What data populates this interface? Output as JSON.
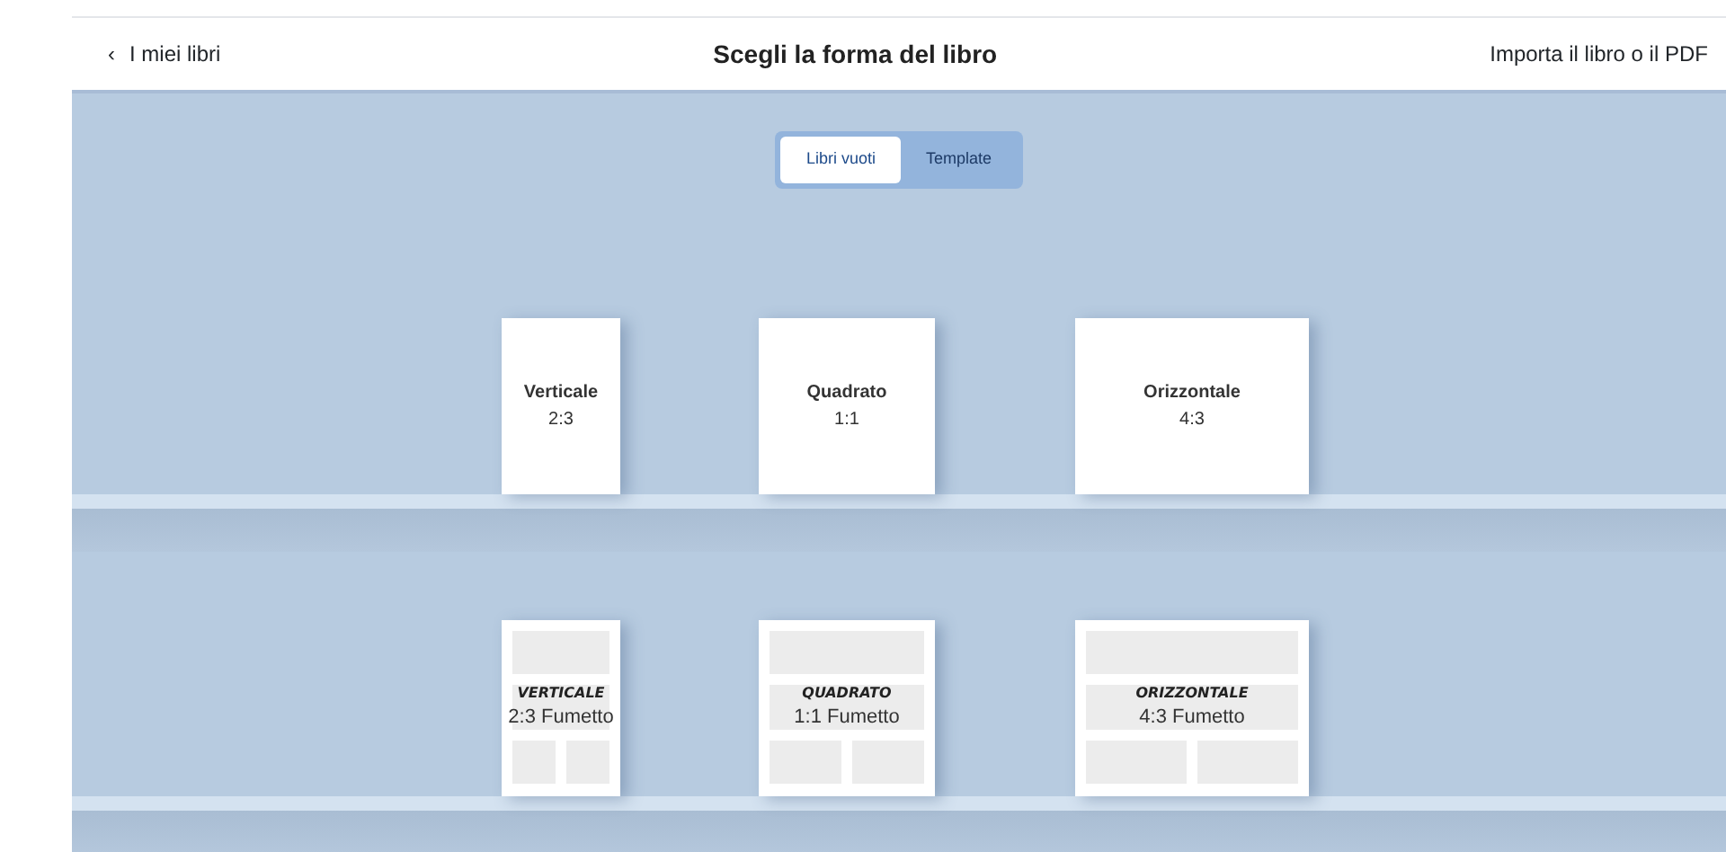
{
  "header": {
    "back": "‹",
    "back_label": "I miei libri",
    "title": "Scegli la forma del libro",
    "import": "Importa il libro o il PDF"
  },
  "tabs": [
    {
      "label": "Libri vuoti",
      "selected": true
    },
    {
      "label": "Template",
      "selected": false
    }
  ],
  "shelves": [
    {
      "kind": "blank",
      "books": [
        {
          "kind": "portrait",
          "title": "Verticale",
          "subtitle": "2:3"
        },
        {
          "kind": "square",
          "title": "Quadrato",
          "subtitle": "1:1"
        },
        {
          "kind": "landscape",
          "title": "Orizzontale",
          "subtitle": "4:3"
        }
      ]
    },
    {
      "kind": "comic",
      "books": [
        {
          "kind": "portrait",
          "title": "VERTICALE",
          "subtitle": "2:3 Fumetto"
        },
        {
          "kind": "square",
          "title": "QUADRATO",
          "subtitle": "1:1 Fumetto"
        },
        {
          "kind": "landscape",
          "title": "ORIZZONTALE",
          "subtitle": "4:3 Fumetto"
        }
      ]
    }
  ]
}
